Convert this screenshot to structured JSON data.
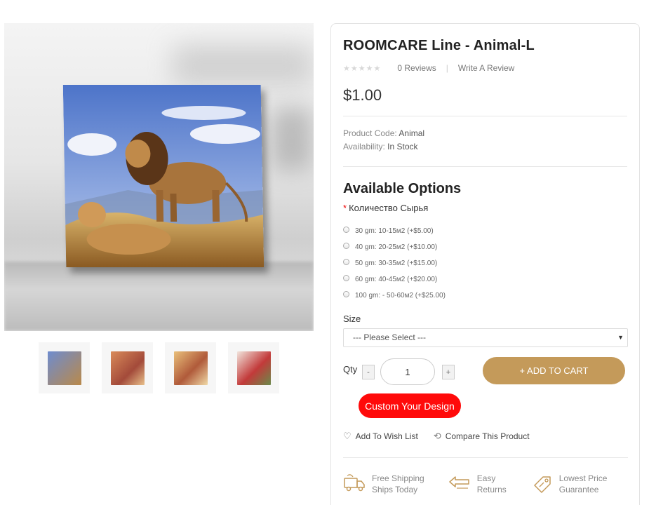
{
  "product": {
    "title": "ROOMCARE Line - Animal-L",
    "reviews_label": "0 Reviews",
    "write_review_label": "Write A Review",
    "rating": 0,
    "price": "$1.00",
    "code_label": "Product Code:",
    "code_value": "Animal",
    "availability_label": "Availability:",
    "availability_value": "In Stock"
  },
  "options": {
    "title": "Available Options",
    "required_label": "Количество Сырья",
    "radio_options": [
      "30 gm: 10-15м2 (+$5.00)",
      "40 gm: 20-25м2 (+$10.00)",
      "50 gm: 30-35м2 (+$15.00)",
      "60 gm: 40-45м2 (+$20.00)",
      "100 gm: - 50-60м2 (+$25.00)"
    ],
    "size_label": "Size",
    "size_selected": "--- Please Select ---"
  },
  "purchase": {
    "qty_label": "Qty",
    "minus": "-",
    "plus": "+",
    "qty_value": "1",
    "add_to_cart": "+ ADD TO CART",
    "custom_design": "Custom Your Design",
    "wishlist": "Add To Wish List",
    "compare": "Compare This Product"
  },
  "features": [
    {
      "line1": "Free Shipping",
      "line2": "Ships Today",
      "icon": "free-shipping-truck-icon"
    },
    {
      "line1": "Easy",
      "line2": "Returns",
      "icon": "back-arrow-icon"
    },
    {
      "line1": "Lowest Price",
      "line2": "Guarantee",
      "icon": "price-tag-icon"
    }
  ],
  "colors": {
    "accent": "#c49a5a",
    "custom_button": "#ff0a0a",
    "required_asterisk": "#e00000"
  }
}
